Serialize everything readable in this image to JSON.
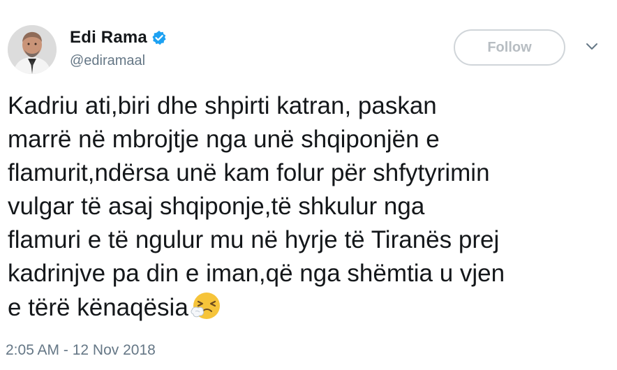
{
  "author": {
    "display_name": "Edi Rama",
    "handle": "@ediramaal",
    "verified": true,
    "avatar_icon": "profile-photo"
  },
  "actions": {
    "follow_label": "Follow",
    "menu_icon": "chevron-down-icon"
  },
  "tweet": {
    "text": "Kadriu ati,biri dhe shpirti katran, paskan\nmarrë në mbrojtje nga unë shqiponjën e\nflamurit,ndërsa unë kam folur për shfytyrimin\nvulgar të asaj shqiponje,të shkulur nga\nflamuri e të ngulur mu në hyrje të Tiranës prej\nkadrinjve pa din e iman,që nga shëmtia u vjen\ne tërë kënaqësia",
    "trailing_emoji": "sneezing-face-emoji",
    "timestamp": "2:05 AM - 12 Nov 2018"
  },
  "colors": {
    "verified_badge": "#1da1f2",
    "text": "#14171a",
    "secondary_text": "#657786",
    "follow_border": "#d0d5d9"
  }
}
